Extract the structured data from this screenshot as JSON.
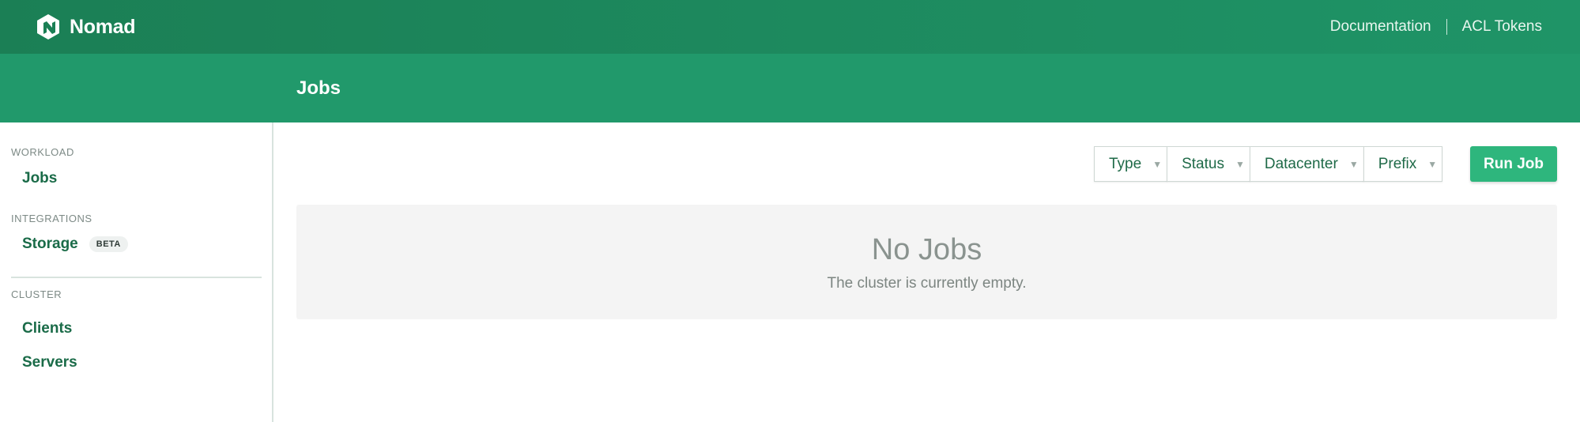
{
  "brand": {
    "name": "Nomad",
    "logo_icon": "nomad-logo-icon"
  },
  "topnav": {
    "links": [
      "Documentation",
      "ACL Tokens"
    ]
  },
  "subnav": {
    "title": "Jobs"
  },
  "sidebar": {
    "sections": [
      {
        "heading": "WORKLOAD",
        "items": [
          {
            "label": "Jobs"
          }
        ]
      },
      {
        "heading": "INTEGRATIONS",
        "items": [
          {
            "label": "Storage",
            "badge": "BETA"
          }
        ]
      },
      {
        "heading": "CLUSTER",
        "items": [
          {
            "label": "Clients"
          },
          {
            "label": "Servers"
          }
        ]
      }
    ]
  },
  "filters": [
    {
      "label": "Type",
      "caret_icon": "caret-down-icon"
    },
    {
      "label": "Status",
      "caret_icon": "caret-down-icon"
    },
    {
      "label": "Datacenter",
      "caret_icon": "caret-down-icon"
    },
    {
      "label": "Prefix",
      "caret_icon": "caret-down-icon"
    }
  ],
  "run_button": {
    "label": "Run Job"
  },
  "empty_state": {
    "title": "No Jobs",
    "message": "The cluster is currently empty."
  },
  "colors": {
    "topbar": "#1b7f55",
    "subnav": "#21996b",
    "run_button": "#2eb67d",
    "sidebar_link": "#1a6b48"
  }
}
